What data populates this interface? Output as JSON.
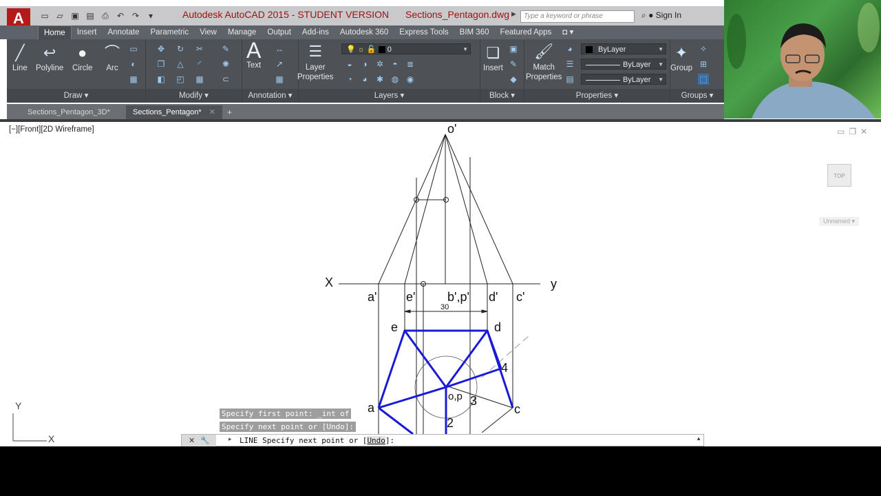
{
  "titlebar": {
    "logo": "A",
    "app_title": "Autodesk AutoCAD 2015 - STUDENT VERSION",
    "file_name": "Sections_Pentagon.dwg",
    "search_placeholder": "Type a keyword or phrase",
    "sign_in": "Sign In"
  },
  "ribbon_tabs": [
    "Home",
    "Insert",
    "Annotate",
    "Parametric",
    "View",
    "Manage",
    "Output",
    "Add-ins",
    "Autodesk 360",
    "Express Tools",
    "BIM 360",
    "Featured Apps"
  ],
  "ribbon": {
    "draw": {
      "title": "Draw",
      "line": "Line",
      "polyline": "Polyline",
      "circle": "Circle",
      "arc": "Arc"
    },
    "modify": {
      "title": "Modify"
    },
    "annotation": {
      "title": "Annotation",
      "text": "Text"
    },
    "layers": {
      "title": "Layers",
      "layer_properties_1": "Layer",
      "layer_properties_2": "Properties",
      "current_layer": "0"
    },
    "block": {
      "title": "Block",
      "insert": "Insert"
    },
    "properties": {
      "title": "Properties",
      "match_1": "Match",
      "match_2": "Properties",
      "color": "ByLayer",
      "linetype": "ByLayer",
      "lineweight": "ByLayer"
    },
    "groups": {
      "title": "Groups",
      "group": "Group"
    }
  },
  "file_tabs": [
    "Sections_Pentagon_3D*",
    "Sections_Pentagon*"
  ],
  "viewport": {
    "label": "[−][Front][2D Wireframe]",
    "viewcube": "TOP",
    "ucs_name": "Unnamed"
  },
  "drawing_labels": {
    "apex": "o'",
    "x": "X",
    "y": "y",
    "a_prime": "a'",
    "e_prime": "e'",
    "bp_prime": "b',p'",
    "d_prime": "d'",
    "c_prime": "c'",
    "dim": "30",
    "e": "e",
    "d": "d",
    "a": "a",
    "c": "c",
    "op": "o,p",
    "n2": "2",
    "n3": "3",
    "n4": "4"
  },
  "command_line": {
    "history_1": "Specify first point: _int of",
    "history_2": "Specify next point or [Undo]:",
    "prompt_prefix": "LINE Specify next point or [",
    "prompt_option": "Undo",
    "prompt_suffix": "]:"
  },
  "ucs": {
    "x": "X",
    "y": "Y"
  },
  "colors": {
    "title_text": "#a01010",
    "ribbon_bg": "#4e5257",
    "pentagon_blue": "#1a1ad6",
    "logo_red": "#b31b1b"
  }
}
